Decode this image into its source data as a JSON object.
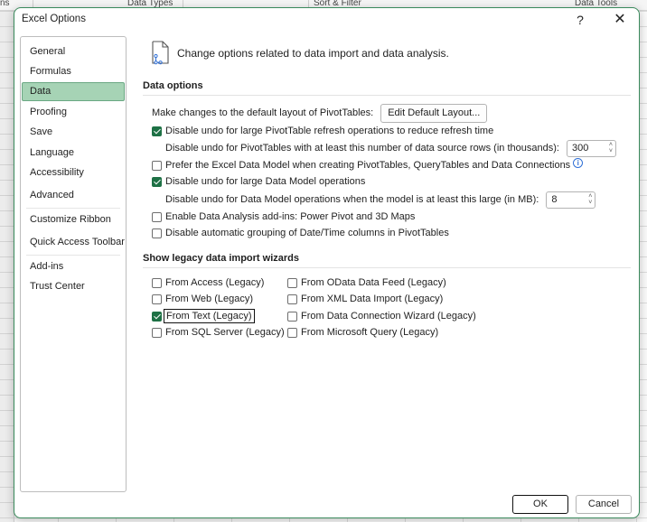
{
  "background": {
    "ribbon_groups": [
      "ns",
      "Data Types",
      "Sort & Filter",
      "Data Tools"
    ]
  },
  "dialog": {
    "title": "Excel Options",
    "help_label": "?",
    "close_label": "✕"
  },
  "sidebar": {
    "items": [
      {
        "label": "General",
        "active": false
      },
      {
        "label": "Formulas",
        "active": false
      },
      {
        "label": "Data",
        "active": true
      },
      {
        "label": "Proofing",
        "active": false
      },
      {
        "label": "Save",
        "active": false
      },
      {
        "label": "Language",
        "active": false
      },
      {
        "label": "Accessibility",
        "active": false
      },
      {
        "label": "Advanced",
        "active": false
      },
      {
        "label": "Customize Ribbon",
        "active": false
      },
      {
        "label": "Quick Access Toolbar",
        "active": false
      },
      {
        "label": "Add-ins",
        "active": false
      },
      {
        "label": "Trust Center",
        "active": false
      }
    ]
  },
  "intro": {
    "icon": "data-document-icon",
    "text": "Change options related to data import and data analysis."
  },
  "data_options": {
    "title": "Data options",
    "layout_label": "Make changes to the default layout of PivotTables:",
    "edit_layout_button": "Edit Default Layout...",
    "disable_undo_pivot": {
      "label": "Disable undo for large PivotTable refresh operations to reduce refresh time",
      "checked": true
    },
    "pivot_rows_label": "Disable undo for PivotTables with at least this number of data source rows (in thousands):",
    "pivot_rows_value": "300",
    "prefer_data_model": {
      "label": "Prefer the Excel Data Model when creating PivotTables, QueryTables and Data Connections",
      "checked": false
    },
    "disable_undo_model": {
      "label": "Disable undo for large Data Model operations",
      "checked": true
    },
    "model_size_label": "Disable undo for Data Model operations when the model is at least this large (in MB):",
    "model_size_value": "8",
    "enable_addins": {
      "label": "Enable Data Analysis add-ins: Power Pivot and 3D Maps",
      "checked": false
    },
    "disable_grouping": {
      "label": "Disable automatic grouping of Date/Time columns in PivotTables",
      "checked": false
    }
  },
  "legacy": {
    "title": "Show legacy data import wizards",
    "items": [
      {
        "label": "From Access (Legacy)",
        "checked": false
      },
      {
        "label": "From Web (Legacy)",
        "checked": false
      },
      {
        "label": "From Text (Legacy)",
        "checked": true
      },
      {
        "label": "From SQL Server (Legacy)",
        "checked": false
      },
      {
        "label": "From OData Data Feed (Legacy)",
        "checked": false
      },
      {
        "label": "From XML Data Import (Legacy)",
        "checked": false
      },
      {
        "label": "From Data Connection Wizard (Legacy)",
        "checked": false
      },
      {
        "label": "From Microsoft Query (Legacy)",
        "checked": false
      }
    ]
  },
  "footer": {
    "ok_label": "OK",
    "cancel_label": "Cancel"
  },
  "colors": {
    "accent": "#1e7145",
    "active_nav": "#a6d3b5",
    "dialog_border": "#3a8a5c"
  }
}
